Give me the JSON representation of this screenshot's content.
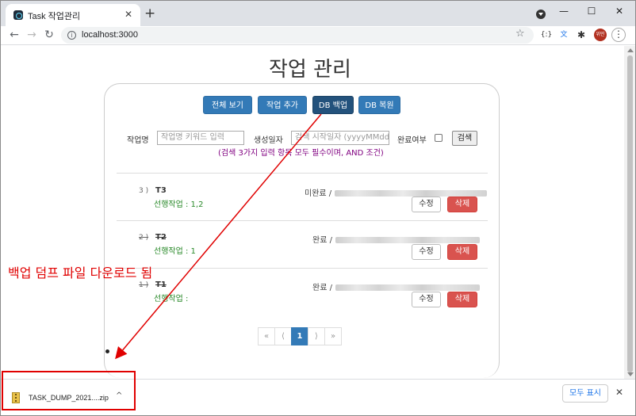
{
  "browser": {
    "tab_title": "Task 작업관리",
    "tab_close": "✕",
    "new_tab": "+",
    "url": "localhost:3000",
    "window_buttons": {
      "minimize": "—",
      "maximize": "☐",
      "close": "✕"
    },
    "nav": {
      "back": "←",
      "forward": "→",
      "reload": "↻"
    },
    "info": "i",
    "star": "☆",
    "extensions": [
      "{:}",
      "文",
      "✱"
    ],
    "avatar": "위민",
    "menu": "⋮"
  },
  "page": {
    "title": "작업 관리",
    "buttons": {
      "view_all": "전체 보기",
      "add_task": "작업 추가",
      "db_backup": "DB 백업",
      "db_restore": "DB 복원"
    },
    "search": {
      "name_label": "작업명",
      "name_placeholder": "작업명 키워드 입력",
      "date_label": "생성일자",
      "date_placeholder": "검색 시작일자 (yyyyMMdd)",
      "done_label": "완료여부",
      "search_button": "검색",
      "hint": "(검색 3가지 입력 항목 모두 필수이며, AND 조건)"
    },
    "tasks": [
      {
        "num": "3 )",
        "title": "T3",
        "prereq": "선행작업 : 1,2",
        "status": "미완료 /",
        "completed": false,
        "edit": "수정",
        "delete": "삭제"
      },
      {
        "num": "2 )",
        "title": "T2",
        "prereq": "선행작업 : 1",
        "status": "완료 /",
        "completed": true,
        "edit": "수정",
        "delete": "삭제"
      },
      {
        "num": "1 )",
        "title": "T1",
        "prereq": "선행작업 :",
        "status": "완료 /",
        "completed": true,
        "edit": "수정",
        "delete": "삭제"
      }
    ],
    "pagination": {
      "first": "«",
      "prev": "⟨",
      "current": "1",
      "next": "⟩",
      "last": "»"
    }
  },
  "annotation": {
    "text": "백업 덤프 파일 다운로드 됨",
    "color": "#e00000"
  },
  "download_shelf": {
    "file_name": "TASK_DUMP_2021....zip",
    "chevron": "^",
    "show_all": "모두 표시",
    "close": "✕"
  }
}
